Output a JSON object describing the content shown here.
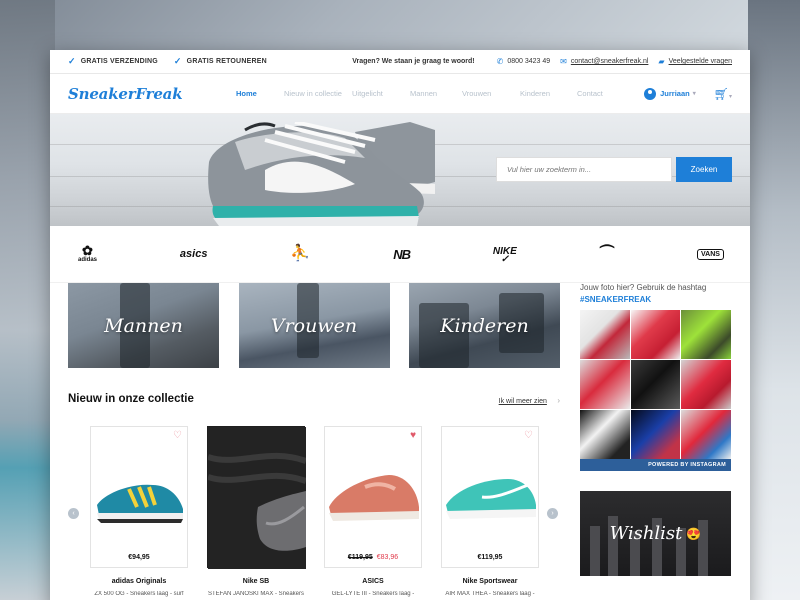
{
  "topbar": {
    "usp1": "GRATIS VERZENDING",
    "usp2": "GRATIS RETOUNEREN",
    "question": "Vragen? We staan je graag te woord!",
    "phone": "0800 3423 49",
    "email": "contact@sneakerfreak.nl",
    "faq": "Veelgestelde vragen"
  },
  "nav": {
    "logo": "SneakerFreak",
    "items": [
      "Home",
      "Nieuw in collectie",
      "Uitgelicht",
      "Mannen",
      "Vrouwen",
      "Kinderen",
      "Contact"
    ],
    "user": "Jurriaan"
  },
  "search": {
    "placeholder": "Vul hier uw zoekterm in...",
    "button": "Zoeken"
  },
  "brands": [
    "adidas",
    "asics",
    "Jordan",
    "New Balance",
    "NIKE",
    "PUMA",
    "VANS"
  ],
  "categories": [
    "Mannen",
    "Vrouwen",
    "Kinderen"
  ],
  "section": {
    "title": "Nieuw in onze collectie",
    "more": "Ik wil meer zien"
  },
  "products": [
    {
      "brand": "adidas Originals",
      "desc": "ZX 500 OG - Sneakers laag - surf",
      "price": "€94,95"
    },
    {
      "brand": "Nike SB",
      "desc": "STEFAN JANOSKI MAX - Sneakers",
      "price": ""
    },
    {
      "brand": "ASICS",
      "desc": "GEL-LYTE III - Sneakers laag -",
      "old_price": "€119,95",
      "price": "€83,96"
    },
    {
      "brand": "Nike Sportswear",
      "desc": "AIR MAX THEA - Sneakers laag -",
      "price": "€119,95"
    }
  ],
  "sidebar": {
    "instagram_title": "Jouw foto hier? Gebruik de hashtag",
    "hashtag": "#SNEAKERFREAK",
    "powered": "POWERED BY INSTAGRAM",
    "wishlist": "Wishlist",
    "wishlist_emoji": "😍"
  },
  "icons": {
    "check": "check-icon",
    "phone": "phone-icon",
    "mail": "mail-icon",
    "chat": "chat-icon",
    "user": "user-icon",
    "cart": "cart-icon",
    "heart": "heart-icon"
  },
  "colors": {
    "accent": "#1e7fd8",
    "sale": "#e03a4a",
    "instagram_bar": "#2d5f9a"
  }
}
